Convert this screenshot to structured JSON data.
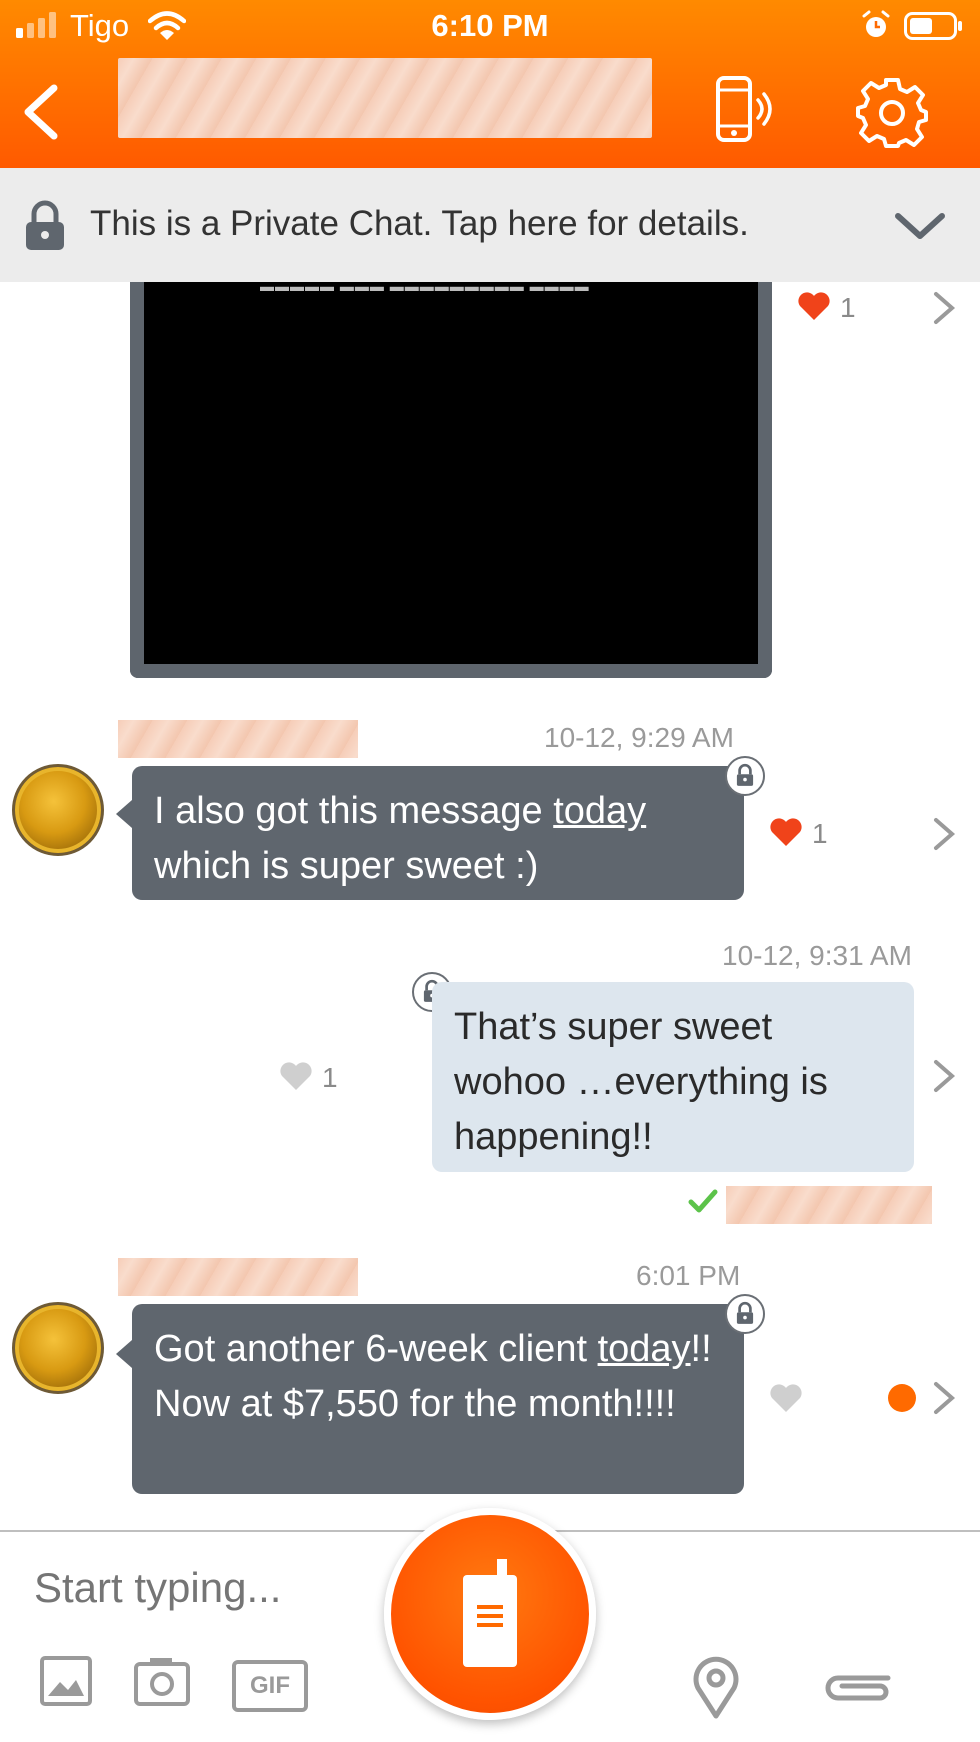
{
  "status_bar": {
    "carrier": "Tigo",
    "time": "6:10 PM"
  },
  "banner": {
    "text": "This is a Private Chat. Tap here for details."
  },
  "messages": [
    {
      "id": "video",
      "likes": "1"
    },
    {
      "id": "m1",
      "timestamp": "10-12, 9:29 AM",
      "text_a": "I also got this message ",
      "link": "today",
      "text_b": " which is super sweet :)",
      "likes": "1"
    },
    {
      "id": "m2",
      "timestamp": "10-12, 9:31 AM",
      "text": "That’s super sweet wohoo …everything is happening!!",
      "likes": "1"
    },
    {
      "id": "m3",
      "timestamp": "6:01 PM",
      "text_a": "Got another 6-week client ",
      "link": "today",
      "text_b": "!! Now at $7,550 for the month!!!!"
    }
  ],
  "composer": {
    "placeholder": "Start typing...",
    "gif_label": "GIF"
  },
  "colors": {
    "accent": "#ff6a00",
    "incoming_bubble": "#5f666e",
    "outgoing_bubble": "#dde6ee",
    "heart": "#f0431a"
  }
}
